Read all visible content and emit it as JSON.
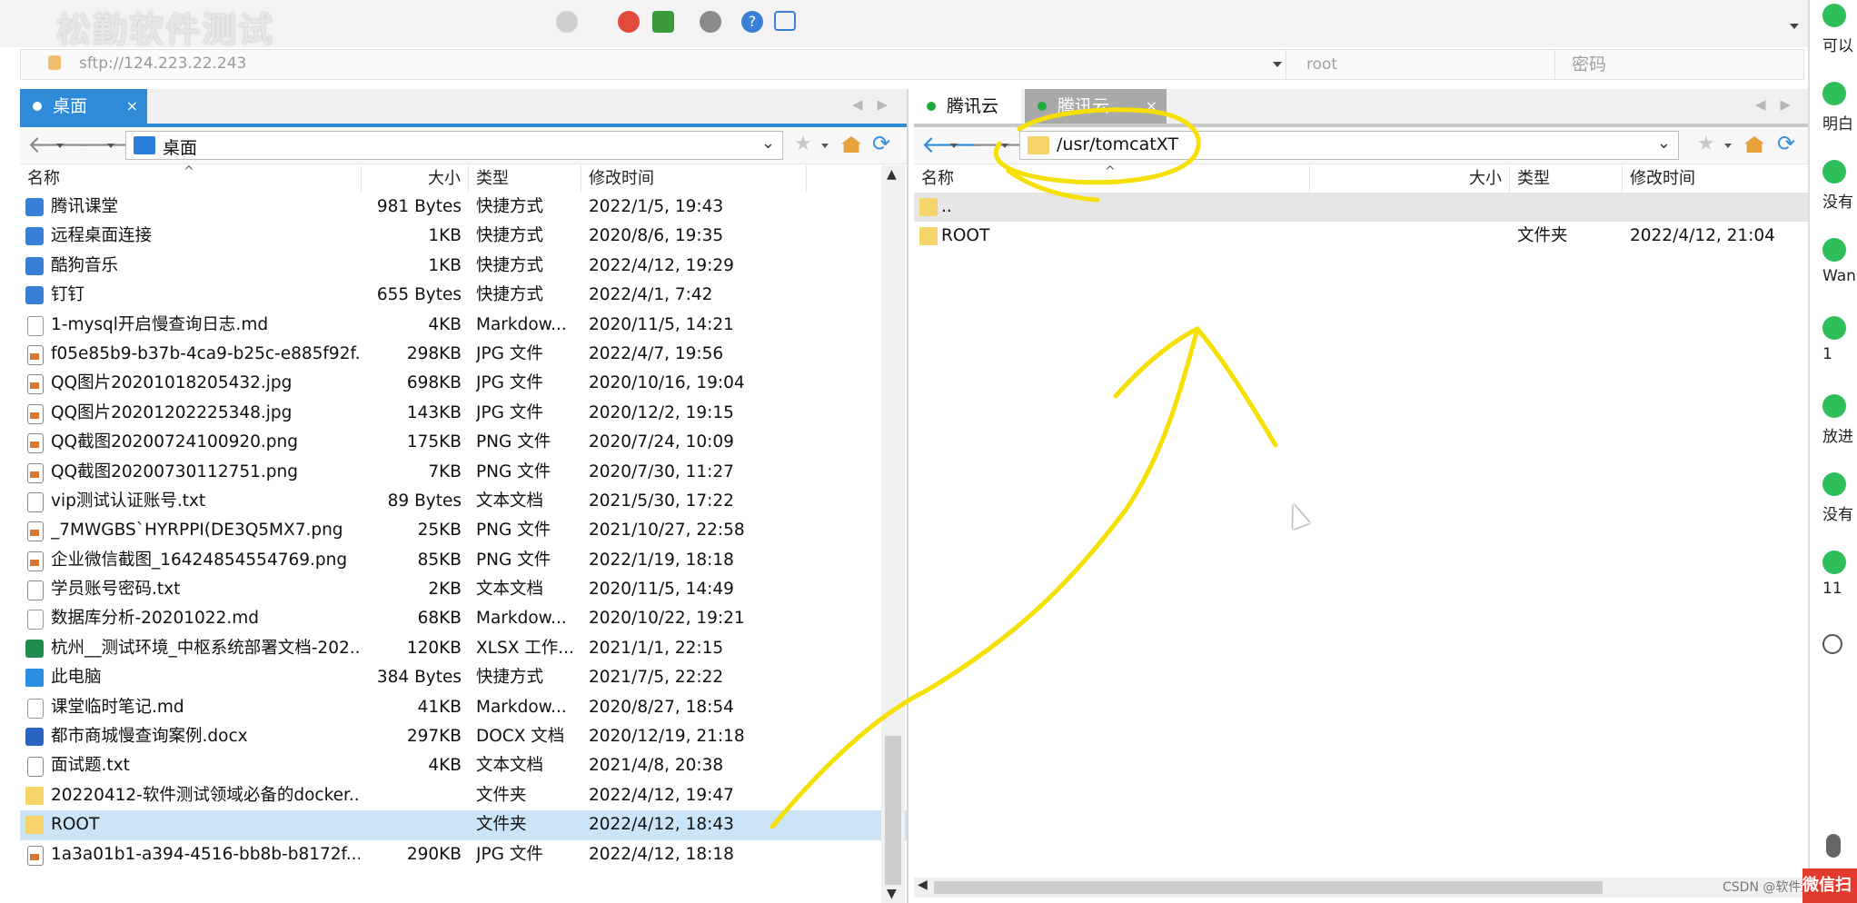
{
  "toolbar": {
    "watermark_title": "松勤软件测试",
    "icons": [
      "new-session-icon",
      "open-icon",
      "transfer-icon",
      "status-icon",
      "sync-icon",
      "settings-icon",
      "help-icon",
      "chat-icon"
    ]
  },
  "address": {
    "url": "sftp://124.223.22.243",
    "user_placeholder": "root",
    "password_placeholder": "密码"
  },
  "left": {
    "tab_label": "桌面",
    "path": "桌面",
    "columns": {
      "name": "名称",
      "size": "大小",
      "type": "类型",
      "modified": "修改时间"
    },
    "files": [
      {
        "name": "腾讯课堂",
        "size": "981 Bytes",
        "type": "快捷方式",
        "modified": "2022/1/5, 19:43",
        "icon": "lnk"
      },
      {
        "name": "远程桌面连接",
        "size": "1KB",
        "type": "快捷方式",
        "modified": "2020/8/6, 19:35",
        "icon": "lnk"
      },
      {
        "name": "酷狗音乐",
        "size": "1KB",
        "type": "快捷方式",
        "modified": "2022/4/12, 19:29",
        "icon": "lnk"
      },
      {
        "name": "钉钉",
        "size": "655 Bytes",
        "type": "快捷方式",
        "modified": "2022/4/1, 7:42",
        "icon": "lnk"
      },
      {
        "name": "1-mysql开启慢查询日志.md",
        "size": "4KB",
        "type": "Markdow...",
        "modified": "2020/11/5, 14:21",
        "icon": "md"
      },
      {
        "name": "f05e85b9-b37b-4ca9-b25c-e885f92f...",
        "size": "298KB",
        "type": "JPG 文件",
        "modified": "2022/4/7, 19:56",
        "icon": "img"
      },
      {
        "name": "QQ图片20201018205432.jpg",
        "size": "698KB",
        "type": "JPG 文件",
        "modified": "2020/10/16, 19:04",
        "icon": "img"
      },
      {
        "name": "QQ图片20201202225348.jpg",
        "size": "143KB",
        "type": "JPG 文件",
        "modified": "2020/12/2, 19:15",
        "icon": "img"
      },
      {
        "name": "QQ截图20200724100920.png",
        "size": "175KB",
        "type": "PNG 文件",
        "modified": "2020/7/24, 10:09",
        "icon": "img"
      },
      {
        "name": "QQ截图20200730112751.png",
        "size": "7KB",
        "type": "PNG 文件",
        "modified": "2020/7/30, 11:27",
        "icon": "img"
      },
      {
        "name": "vip测试认证账号.txt",
        "size": "89 Bytes",
        "type": "文本文档",
        "modified": "2021/5/30, 17:22",
        "icon": "doc"
      },
      {
        "name": "_7MWGBS`HYRPPI(DE3Q5MX7.png",
        "size": "25KB",
        "type": "PNG 文件",
        "modified": "2021/10/27, 22:58",
        "icon": "img"
      },
      {
        "name": "企业微信截图_16424854554769.png",
        "size": "85KB",
        "type": "PNG 文件",
        "modified": "2022/1/19, 18:18",
        "icon": "img"
      },
      {
        "name": "学员账号密码.txt",
        "size": "2KB",
        "type": "文本文档",
        "modified": "2020/11/5, 14:49",
        "icon": "doc"
      },
      {
        "name": "数据库分析-20201022.md",
        "size": "68KB",
        "type": "Markdow...",
        "modified": "2020/10/22, 19:21",
        "icon": "md"
      },
      {
        "name": "杭州__测试环境_中枢系统部署文档-202...",
        "size": "120KB",
        "type": "XLSX 工作...",
        "modified": "2021/1/1, 22:15",
        "icon": "xls"
      },
      {
        "name": "此电脑",
        "size": "384 Bytes",
        "type": "快捷方式",
        "modified": "2021/7/5, 22:22",
        "icon": "pc"
      },
      {
        "name": "课堂临时笔记.md",
        "size": "41KB",
        "type": "Markdow...",
        "modified": "2020/8/27, 18:54",
        "icon": "md"
      },
      {
        "name": "都市商城慢查询案例.docx",
        "size": "297KB",
        "type": "DOCX 文档",
        "modified": "2020/12/19, 21:18",
        "icon": "word"
      },
      {
        "name": "面试题.txt",
        "size": "4KB",
        "type": "文本文档",
        "modified": "2021/4/8, 20:38",
        "icon": "doc"
      },
      {
        "name": "20220412-软件测试领域必备的docker...",
        "size": "",
        "type": "文件夹",
        "modified": "2022/4/12, 19:47",
        "icon": "folder"
      },
      {
        "name": "ROOT",
        "size": "",
        "type": "文件夹",
        "modified": "2022/4/12, 18:43",
        "icon": "folder",
        "selected": true
      },
      {
        "name": "1a3a01b1-a394-4516-bb8b-b8172f...",
        "size": "290KB",
        "type": "JPG 文件",
        "modified": "2022/4/12, 18:18",
        "icon": "img"
      }
    ]
  },
  "right": {
    "tabs": [
      {
        "label": "腾讯云"
      },
      {
        "label": "腾讯云"
      }
    ],
    "path": "/usr/tomcatXT",
    "columns": {
      "name": "名称",
      "size": "大小",
      "type": "类型",
      "modified": "修改时间"
    },
    "files": [
      {
        "name": "..",
        "size": "",
        "type": "",
        "modified": "",
        "icon": "folder"
      },
      {
        "name": "ROOT",
        "size": "",
        "type": "文件夹",
        "modified": "2022/4/12, 21:04",
        "icon": "folder"
      }
    ]
  },
  "chat": {
    "items": [
      "可以",
      "明白",
      "没有",
      "Wan",
      "1",
      "放进",
      "没有",
      "11"
    ]
  },
  "footer": {
    "csdn": "CSDN @软件测试",
    "badge": "微信扫"
  },
  "colors": {
    "accent": "#2f8ad8",
    "selection": "#cce4f7",
    "annotation": "#f5e000",
    "wechat": "#2fbf5a"
  }
}
